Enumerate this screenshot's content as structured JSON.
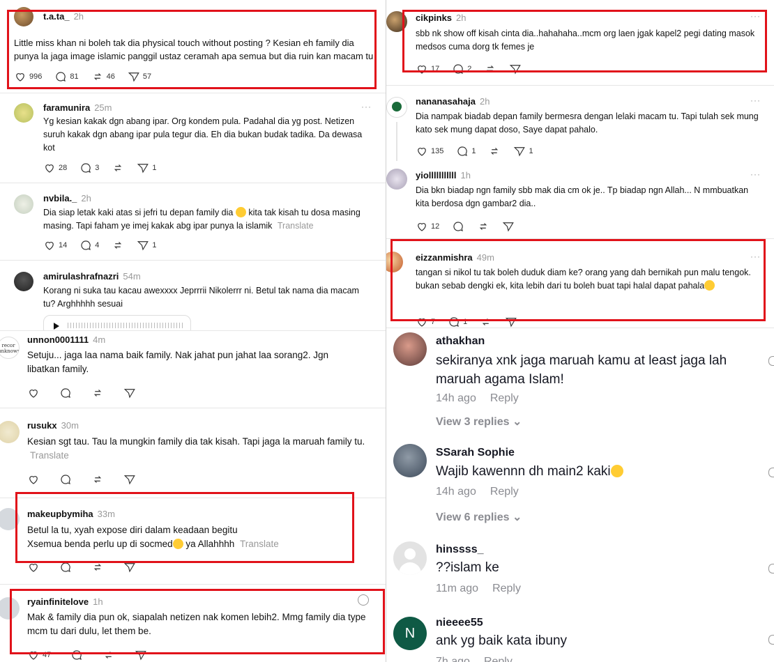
{
  "left": {
    "posts": [
      {
        "user": "t.a.ta_",
        "time": "2h",
        "text": "Little miss khan ni boleh tak dia physical touch without posting ? Kesian eh family dia punya la jaga image islamic panggil ustaz ceramah apa semua but dia ruin kan macam tu",
        "likes": "996",
        "replies": "81",
        "reposts": "46",
        "shares": "57"
      },
      {
        "user": "faramunira",
        "time": "25m",
        "text": "Yg kesian kakak dgn abang ipar. Org kondem pula. Padahal dia yg post. Netizen suruh kakak dgn abang ipar pula tegur dia. Eh dia bukan budak tadika. Da dewasa kot",
        "likes": "28",
        "replies": "3",
        "shares": "1"
      },
      {
        "user": "nvbila._",
        "time": "2h",
        "text": "Dia siap letak kaki atas si jefri tu depan family dia",
        "text2": "kita tak kisah tu dosa masing masing. Tapi faham ye imej kakak abg ipar punya la islamik",
        "translate": "Translate",
        "likes": "14",
        "replies": "4",
        "shares": "1"
      },
      {
        "user": "amirulashrafnazri",
        "time": "54m",
        "text": "Korang ni suka tau kacau awexxxx Jeprrrii Nikolerrr ni. Betul tak nama dia macam tu? Arghhhhh sesuai"
      },
      {
        "user": "unnon0001111",
        "time": "4m",
        "text": "Setuju... jaga laa nama baik family. Nak jahat pun jahat laa sorang2. Jgn libatkan family.",
        "avatar_text": "recor unknown"
      },
      {
        "user": "rusukx",
        "time": "30m",
        "text": "Kesian sgt tau. Tau la mungkin family dia tak kisah. Tapi jaga la maruah family tu.",
        "translate": "Translate"
      },
      {
        "user": "makeupbymiha",
        "time": "33m",
        "text": "Betul la tu, xyah expose diri dalam keadaan begitu",
        "text2": "Xsemua benda perlu up di socmed",
        "text3": "ya Allahhhh",
        "translate": "Translate"
      },
      {
        "user": "ryainfinitelove",
        "time": "1h",
        "text": "Mak & family dia pun ok, siapalah netizen nak komen lebih2. Mmg family dia type mcm tu dari dulu, let them be.",
        "likes": "47"
      }
    ]
  },
  "right_top": {
    "posts": [
      {
        "user": "cikpinks",
        "time": "2h",
        "text": "sbb nk show off kisah cinta dia..hahahaha..mcm org laen jgak kapel2 pegi dating masok medsos cuma dorg tk femes je",
        "likes": "17",
        "replies": "2"
      },
      {
        "user": "nananasahaja",
        "time": "2h",
        "text": "Dia nampak biadab depan family bermesra dengan lelaki macam tu. Tapi tulah sek mung kato sek mung dapat doso, Saye dapat pahalo.",
        "likes": "135",
        "replies": "1",
        "shares": "1"
      },
      {
        "user": "yiolllllllllll",
        "time": "1h",
        "text": "Dia bkn biadap ngn family sbb mak dia cm ok je.. Tp biadap ngn Allah... N mmbuatkan kita berdosa dgn gambar2 dia..",
        "likes": "12"
      },
      {
        "user": "eizzanmishra",
        "time": "49m",
        "text": "tangan si nikol tu tak boleh duduk diam ke? orang yang dah bernikah pun malu tengok. bukan sebab dengki ek, kita lebih dari tu boleh buat tapi halal dapat pahala",
        "likes": "7",
        "replies": "1"
      }
    ]
  },
  "right_bottom": {
    "comments": [
      {
        "user": "athakhan",
        "text": "sekiranya xnk jaga maruah kamu at least jaga lah maruah agama Islam!",
        "time": "14h ago",
        "reply": "Reply",
        "view": "View 3 replies"
      },
      {
        "user": "SSarah Sophie",
        "text": "Wajib kawennn dh main2 kaki",
        "time": "14h ago",
        "reply": "Reply",
        "view": "View 6 replies"
      },
      {
        "user": "hinssss_",
        "text": "??islam ke",
        "time": "11m ago",
        "reply": "Reply"
      },
      {
        "user": "nieeee55",
        "text": "ank yg baik kata ibuny",
        "time": "7h ago",
        "reply": "Reply",
        "avatar_letter": "N"
      }
    ]
  },
  "colors": {
    "highlight": "#e1121a",
    "muted": "#999999",
    "tiktok_muted": "#8a8b91",
    "avatar_n": "#0f5a45"
  }
}
